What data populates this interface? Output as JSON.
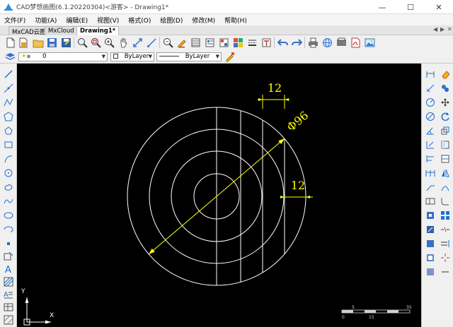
{
  "window": {
    "title": "CAD梦想画图(6.1.20220304)<游客> - Drawing1*",
    "minimize_glyph": "—",
    "maximize_glyph": "☐",
    "close_glyph": "✕"
  },
  "menu": {
    "items": [
      "文件(F)",
      "功能(A)",
      "编辑(E)",
      "视图(V)",
      "格式(O)",
      "绘图(D)",
      "修改(M)",
      "帮助(H)"
    ]
  },
  "tabs": {
    "items": [
      "MxCAD云图",
      "MxCloud",
      "Drawing1*"
    ],
    "nav_left": "◀",
    "nav_right": "▶",
    "nav_close": "✕",
    "active_index": 2
  },
  "toolbar_icons": [
    "new-file-icon",
    "open-file-icon",
    "folder-icon",
    "save-icon",
    "save-as-icon",
    "undo-icon",
    "undo-dropdown-icon",
    "zoom-realtime-icon",
    "zoom-window-icon",
    "pan-icon",
    "zoom-extents-icon",
    "match-properties-icon",
    "zoom-previous-icon",
    "pencil-icon",
    "layer-manager-icon",
    "color-icon",
    "linetype-icon",
    "text-style-icon",
    "undo-arrow-icon",
    "redo-arrow-icon",
    "print-icon",
    "globe-icon",
    "plot-icon",
    "pdf-icon",
    "image-icon"
  ],
  "properties_bar": {
    "layer_value": "0",
    "color_value": "ByLayer",
    "linetype_value": "ByLayer"
  },
  "drawing": {
    "dimension_diameter": "Φ96",
    "dimension_top": "12",
    "dimension_right": "12",
    "ucs_x_label": "X",
    "ucs_y_label": "Y",
    "scale_labels_top": [
      "5",
      "35"
    ],
    "scale_labels_bottom": [
      "0",
      "15"
    ]
  },
  "colors": {
    "canvas_background": "#000000",
    "geometry": "#ffffff",
    "dimension": "#ffff00",
    "accent_blue": "#1f6fd1"
  }
}
